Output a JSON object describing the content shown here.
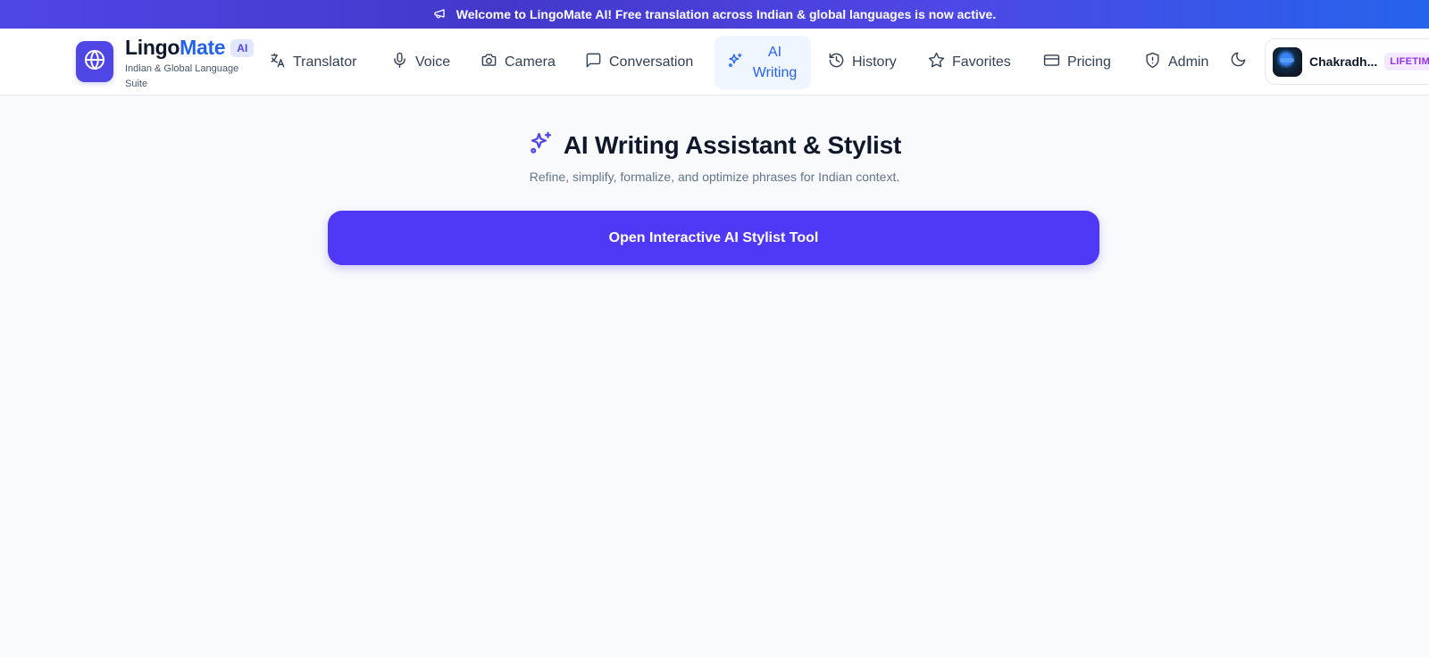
{
  "banner": {
    "icon": "megaphone-icon",
    "text": "Welcome to LingoMate AI! Free translation across Indian & global languages is now active."
  },
  "brand": {
    "logo_icon": "globe-icon",
    "name_part1": "Lingo",
    "name_part2": "Mate",
    "badge": "AI",
    "subtitle": "Indian & Global Language Suite"
  },
  "nav": {
    "items": [
      {
        "label": "Translator",
        "icon": "translate-icon"
      },
      {
        "label": "Voice",
        "icon": "microphone-icon"
      },
      {
        "label": "Camera",
        "icon": "camera-icon"
      },
      {
        "label": "Conversation",
        "icon": "chat-bubble-icon"
      },
      {
        "label": "AI Writing",
        "icon": "sparkles-icon",
        "active": true
      },
      {
        "label": "History",
        "icon": "history-icon"
      },
      {
        "label": "Favorites",
        "icon": "star-icon"
      },
      {
        "label": "Pricing",
        "icon": "credit-card-icon"
      },
      {
        "label": "Admin",
        "icon": "shield-icon"
      }
    ],
    "theme_icon": "moon-icon"
  },
  "user": {
    "name": "Chakradh...",
    "plan": "LIFETIME"
  },
  "main": {
    "title_icon": "sparkles-icon",
    "title": "AI Writing Assistant & Stylist",
    "subtitle": "Refine, simplify, formalize, and optimize phrases for Indian context.",
    "cta_label": "Open Interactive AI Stylist Tool"
  },
  "colors": {
    "accent": "#4f46e5",
    "brand_blue": "#2563eb",
    "cta": "#4f39f6",
    "plan_purple": "#9333ea",
    "background": "#f8fafc"
  }
}
